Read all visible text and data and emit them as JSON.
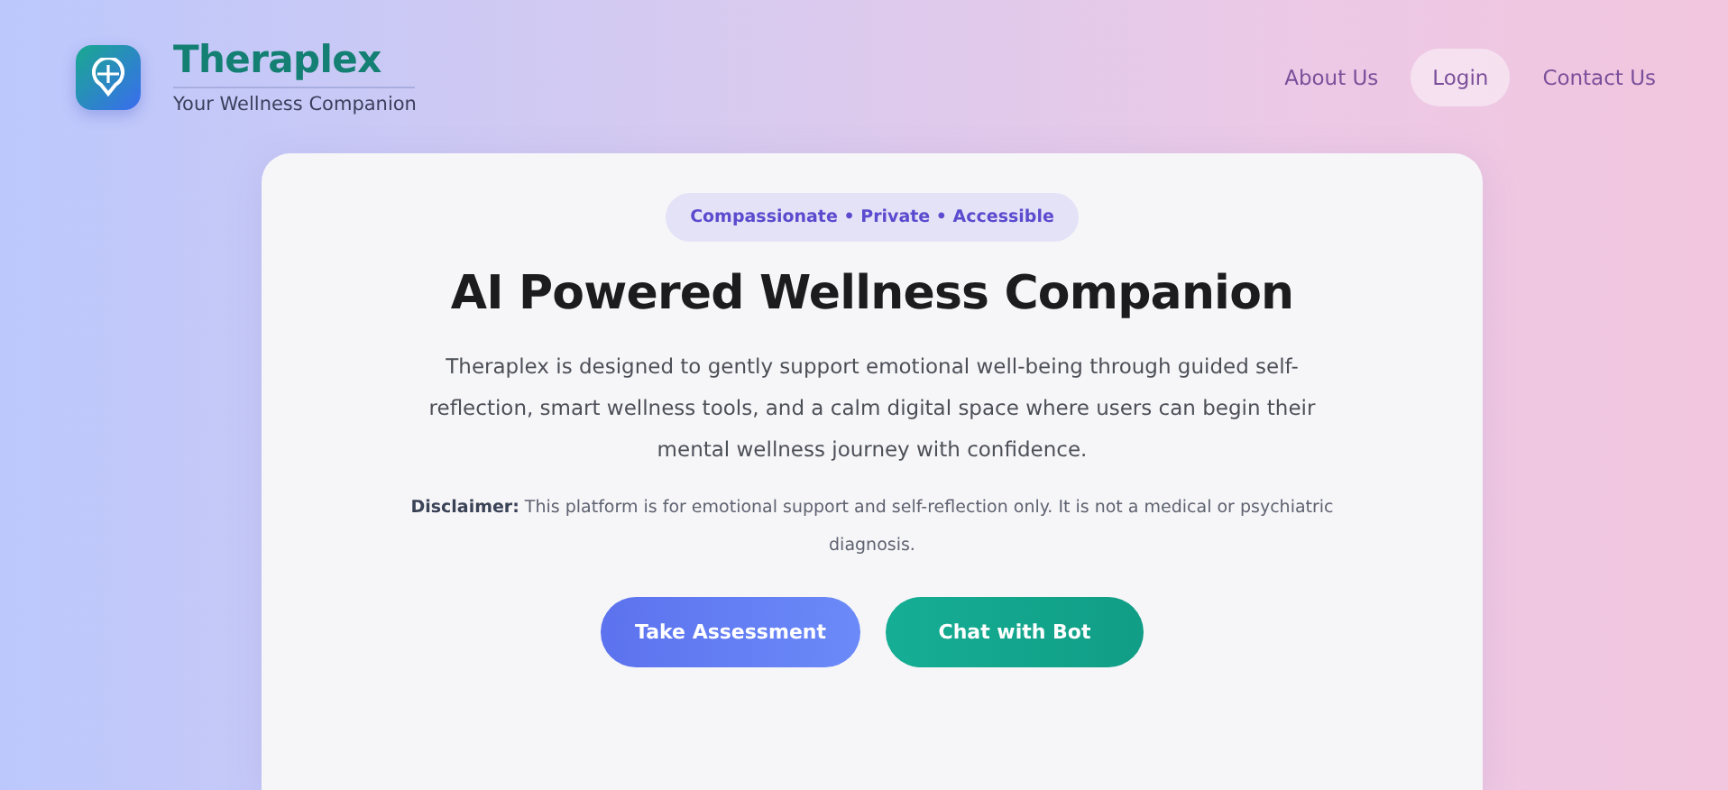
{
  "brand": {
    "name": "Theraplex",
    "tagline": "Your Wellness Companion"
  },
  "nav": [
    {
      "label": "About Us",
      "selected": false
    },
    {
      "label": "Login",
      "selected": true
    },
    {
      "label": "Contact Us",
      "selected": false
    }
  ],
  "hero": {
    "badge": "Compassionate • Private • Accessible",
    "title": "AI Powered Wellness Companion",
    "description": "Theraplex is designed to gently support emotional well-being through guided self-reflection, smart wellness tools, and a calm digital space where users can begin their mental wellness journey with confidence.",
    "disclaimer": "**Disclaimer:** This platform is for emotional support and self-reflection only. It is not a medical or psychiatric diagnosis.",
    "buttons": [
      {
        "label": "Take Assessment",
        "kind": "primary"
      },
      {
        "label": "Chat with Bot",
        "kind": "secondary"
      }
    ]
  }
}
